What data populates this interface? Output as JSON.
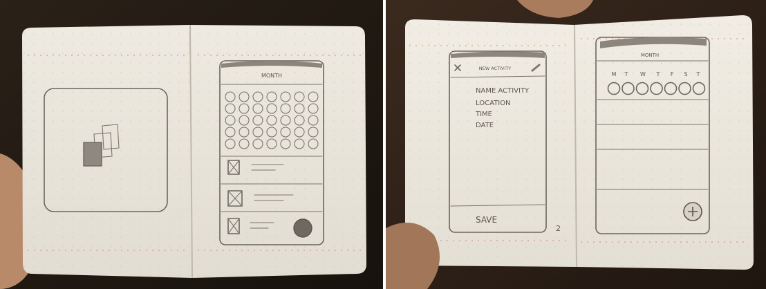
{
  "photo_left": {
    "frame_month": {
      "title": "MONTH"
    }
  },
  "photo_right": {
    "frame_new_activity": {
      "header_title": "NEW ACTIVITY",
      "fields": [
        "NAME ACTIVITY",
        "LOCATION",
        "TIME",
        "DATE"
      ],
      "save_label": "SAVE",
      "page_mark": "2"
    },
    "frame_month": {
      "title": "MONTH",
      "weekdays": [
        "M",
        "T",
        "W",
        "T",
        "F",
        "S",
        "T"
      ]
    }
  },
  "colors": {
    "paper": "#ece8df",
    "pencil": "#6b6560",
    "background": "#1a1510"
  }
}
